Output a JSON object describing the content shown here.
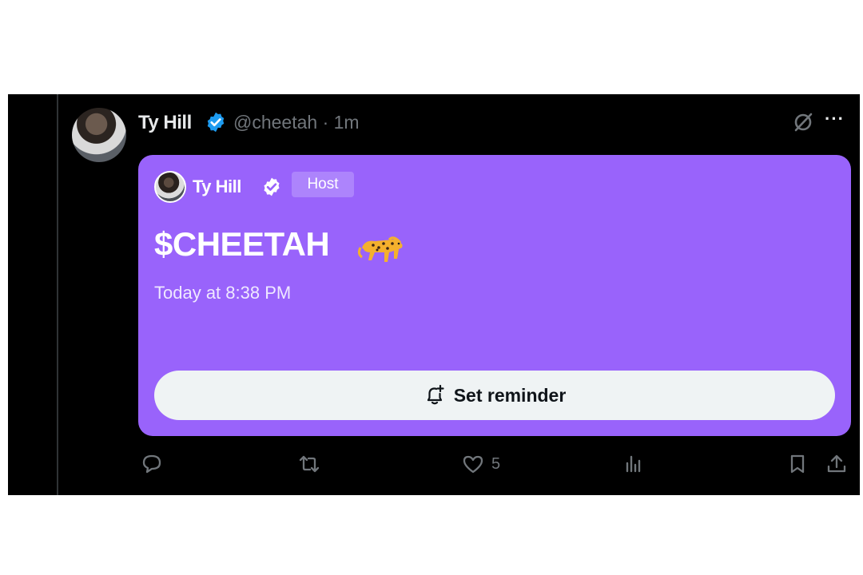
{
  "post": {
    "author_name": "Ty Hill",
    "handle_time": "@cheetah · 1m"
  },
  "space": {
    "host_name": "Ty Hill",
    "host_badge": "Host",
    "title": "$CHEETAH",
    "emoji_icon": "cheetah-emoji",
    "time": "Today at 8:38 PM",
    "reminder_label": "Set reminder",
    "color": "#9963fb"
  },
  "actions": {
    "likes_count": "5"
  },
  "colors": {
    "verified": "#1d9bf0",
    "background": "#000000",
    "muted": "#71767b"
  }
}
